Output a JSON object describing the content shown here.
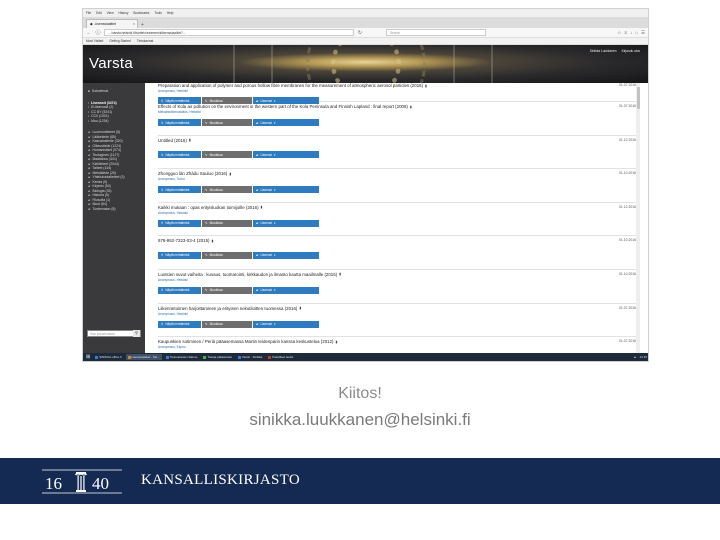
{
  "browser": {
    "menu": [
      "File",
      "Edit",
      "View",
      "History",
      "Bookmarks",
      "Tools",
      "Help"
    ],
    "tab_title": "Lisenssiaaltiet",
    "url": "…/varsta.helsinki.fi/luettelo/esiemerkkilisenssiaaltiet?...",
    "search_placeholder": "Search",
    "bookmarks": [
      "Most Visited",
      "Getting Started",
      "Tietokannat"
    ]
  },
  "site": {
    "brand": "Varsta",
    "user_links": [
      "Sinikka Luukkanen",
      "Kirjaudu ulos"
    ]
  },
  "sidebar": {
    "top_item": "Kokoelmat",
    "groups": [
      [
        "Lisenssit (3474)",
        "Ei-lisenssiä (2)",
        "CC BY (5241)",
        "CC0 (1001)",
        "Muu (1234)"
      ],
      [
        "Luonnontieteet (8)",
        "Lääketiede (85)",
        "Kasvatustiede (320)",
        "Oikeustiede (1224)",
        "Humanistiset (974)",
        "Teologinen (1127)",
        "Maatalous (441)",
        "Kielitieteet (2044)",
        "Taiteet (144)",
        "Metsätiede (26)",
        "Yhteiskuntatieteet (3)",
        "Kemia (5)",
        "Kirjasto (54)",
        "Biologia (33)",
        "Historia (6)",
        "Filosofia (1)",
        "Muut (84)",
        "Tuntematon (8)"
      ]
    ],
    "search_placeholder": "Hae kokoelmasta"
  },
  "listing": {
    "button_labels": [
      "Näytä metatiedot",
      "Muokkaa",
      "Lisenssi"
    ],
    "entries": [
      {
        "title": "Preparation and application of polymer and porous hollow fibre membranes for the measurement of atmospheric aerosol particles (2016)",
        "author": "Anonymous, Helsinki",
        "date": "01.07.2016"
      },
      {
        "title": "Effects of Kola air pollution on the environment in the western part of the Kola Peninsula and Finnish Lapland : final report (2008)",
        "author": "Metsäntutkimuslaitos, Helsinki",
        "date": "01.07.2016"
      },
      {
        "title": "Untitled (2016)",
        "author": "",
        "date": "01.12.2016"
      },
      {
        "title": "Zhongguo làn Zhàdu Sauluo (2016)",
        "author": "Anonymous, Turku",
        "date": "01.10.2016"
      },
      {
        "title": "Kaikki mukaan : opas erityisluokan toimijoille (2016)",
        "author": "Anonymous, Helsinki",
        "date": "01.12.2016"
      },
      {
        "title": "978-952-7323-03-4 (2015)",
        "author": "",
        "date": "01.10.2016"
      },
      {
        "title": "Luotsien suvut vaiheita : kuvaus, tuomarointi, kirkkaudon ja ilmasto kautta maailmalle (2016)",
        "author": "Anonymous, Helsinki",
        "date": "01.10.2016"
      },
      {
        "title": "Liikennetoimen harjoittaminen ja erityisen nekutiloitten tuomessa (2016)",
        "author": "Anonymous, Helsinki",
        "date": "01.07.2016"
      },
      {
        "title": "Kaupunkien sotiminen / Periä pääasemassa Martin teidenparin kanssa keskustelua (2012)",
        "author": "Anonymous, Espoo",
        "date": "01.07.2016"
      }
    ]
  },
  "taskbar": {
    "items": [
      "SINIKKA-office.fi",
      "Lisenssiaaltiet - Mo...",
      "Tietovaraston tilanne",
      "Tietoja julkaisuista",
      "Viestit - Sinikka",
      "Pakolliset tiedot"
    ],
    "clock": "14.15"
  },
  "slide": {
    "thanks": "Kiitos!",
    "email": "sinikka.luukkanen@helsinki.fi",
    "org": "KANSALLISKIRJASTO",
    "logo_year_left": "16",
    "logo_year_right": "40"
  },
  "colors": {
    "footer": "#142a52",
    "button_blue": "#2e7bbf",
    "button_grey": "#6e6e6e",
    "sidebar": "#3a3a3c"
  }
}
